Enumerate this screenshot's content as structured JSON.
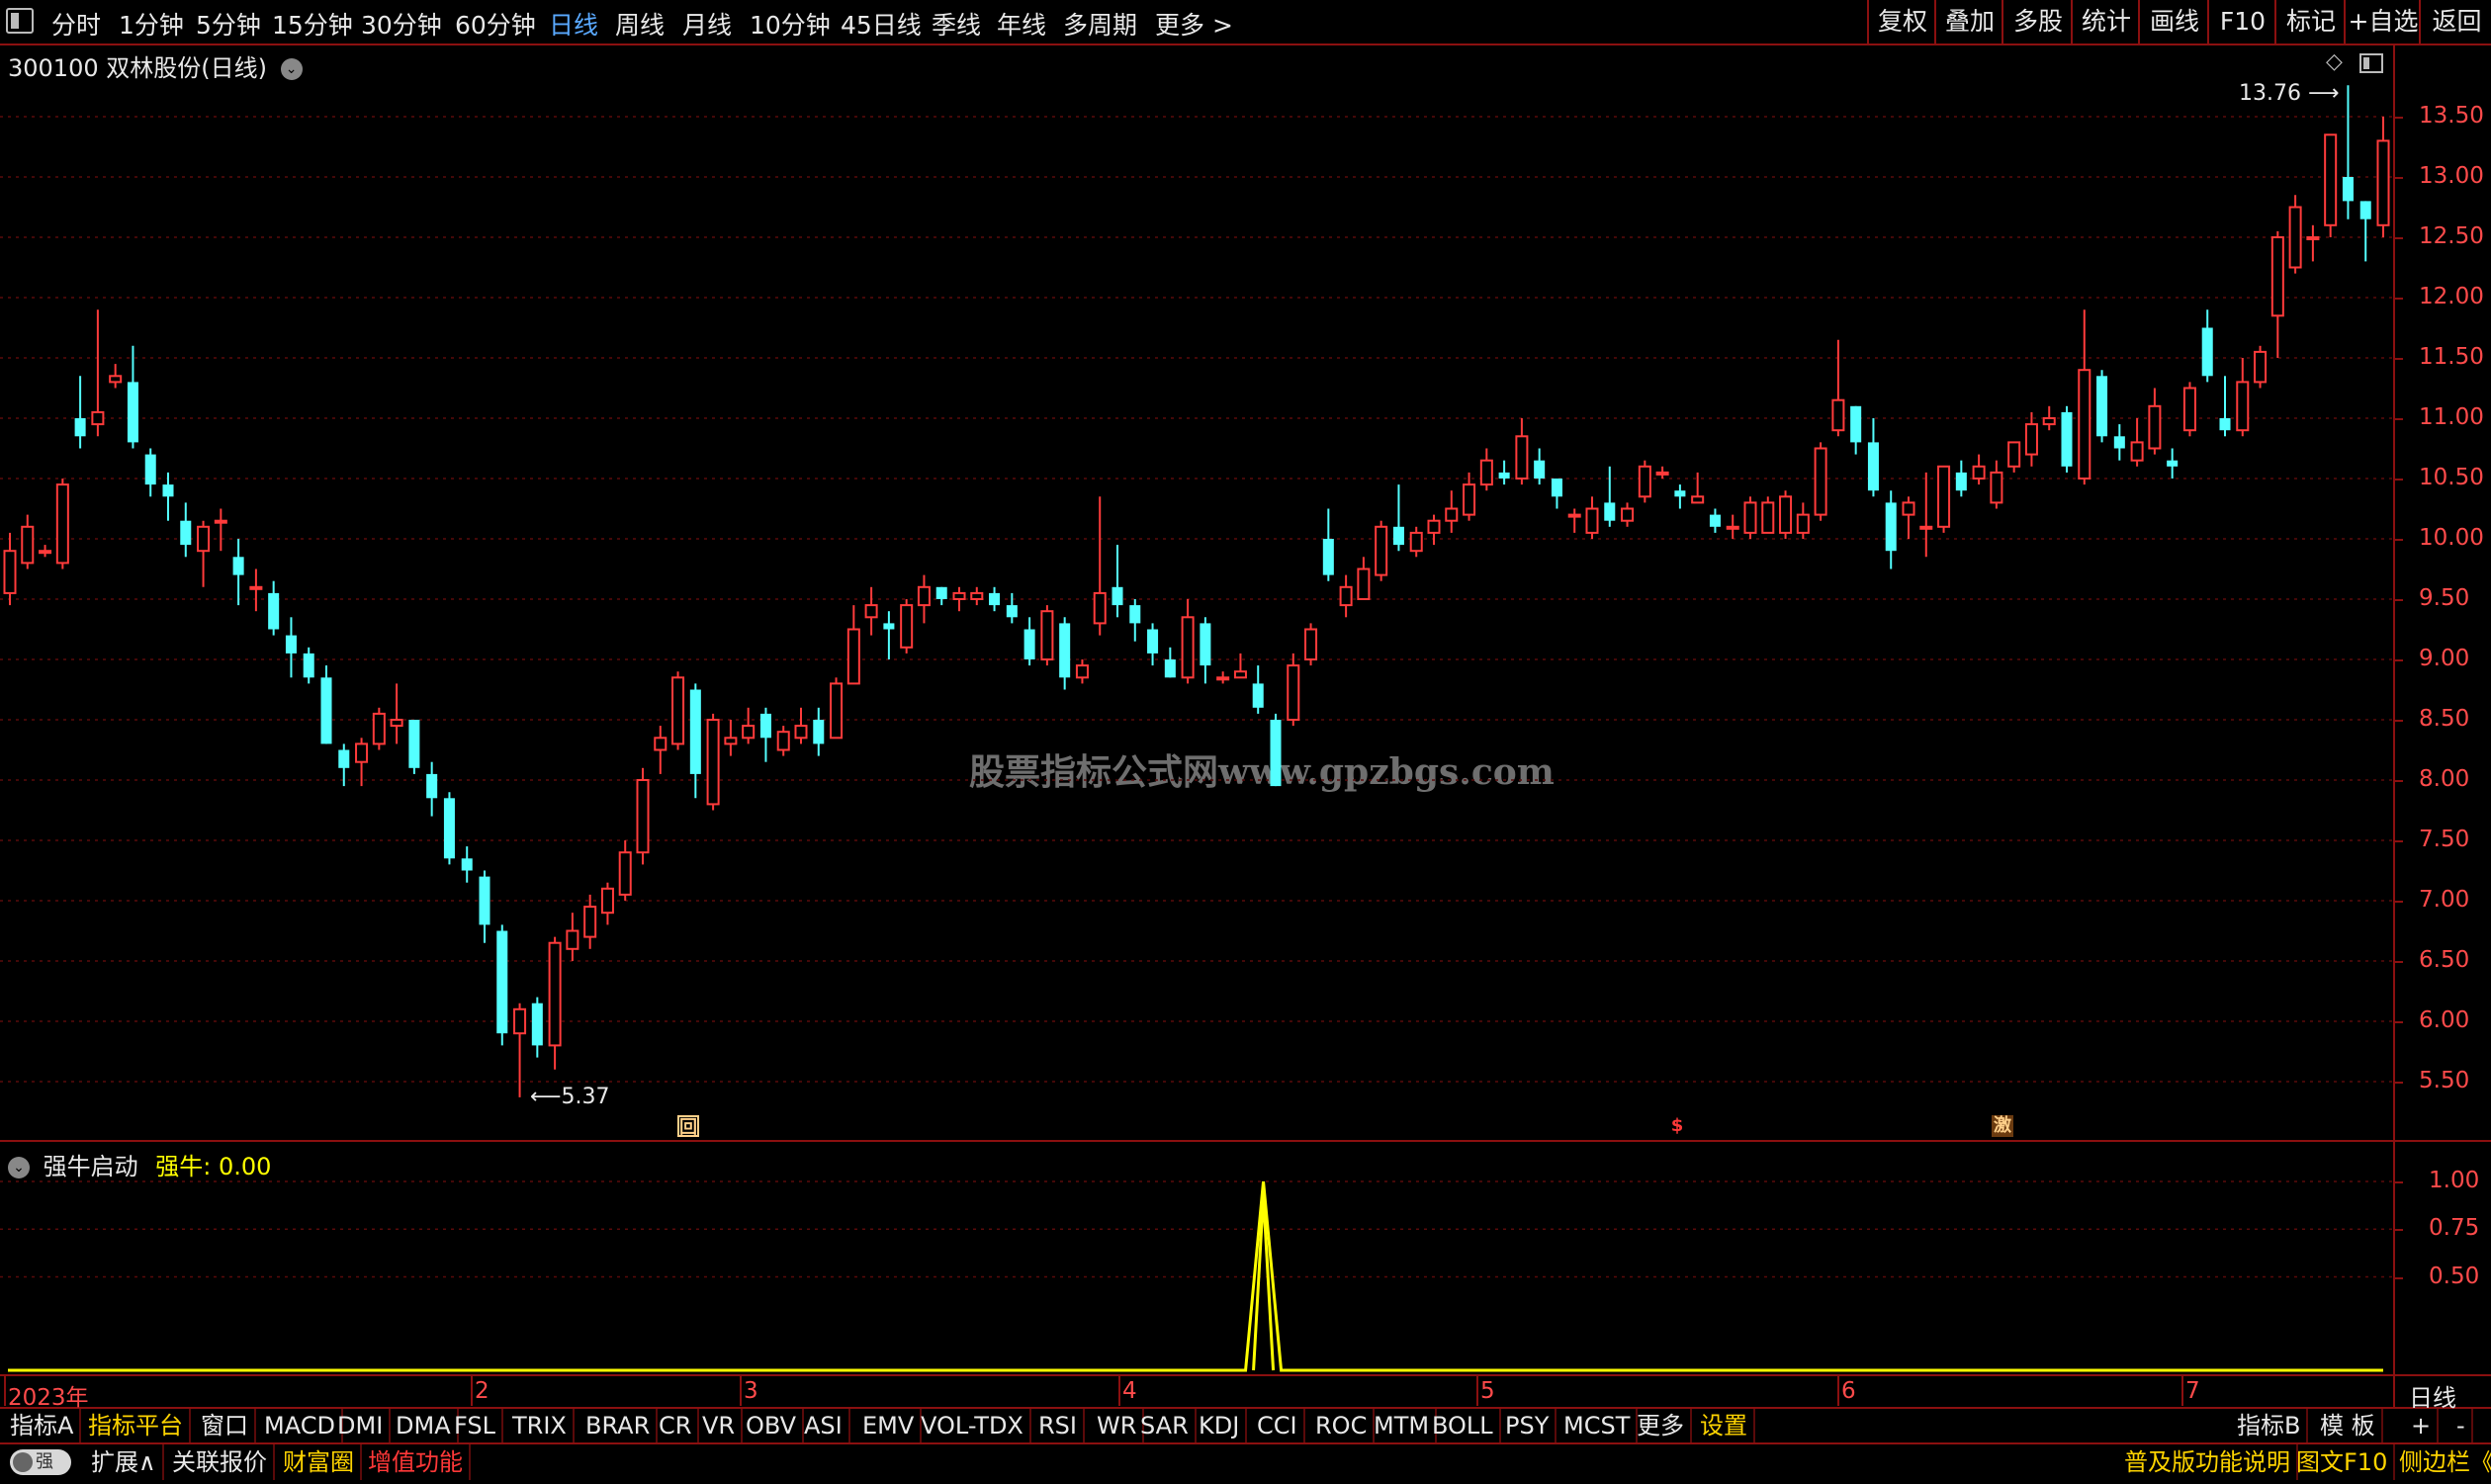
{
  "top_bar": {
    "toggle_icon": "sidebar-toggle-icon",
    "periods": [
      "分时",
      "1分钟",
      "5分钟",
      "15分钟",
      "30分钟",
      "60分钟",
      "日线",
      "周线",
      "月线",
      "10分钟",
      "45日线",
      "季线",
      "年线",
      "多周期",
      "更多 >"
    ],
    "active_period": "日线",
    "right_buttons": [
      "复权",
      "叠加",
      "多股",
      "统计",
      "画线",
      "F10",
      "标记",
      "+自选",
      "返回"
    ]
  },
  "main_chart": {
    "stock_title": "300100 双林股份(日线)",
    "high_label": "13.76",
    "low_label": "5.37",
    "watermark": "股票指标公式网www.gpzbgs.com",
    "markers": [
      {
        "text": "回",
        "color": "#ffd08a"
      },
      {
        "text": "$",
        "color": "#ff3838"
      },
      {
        "text": "激",
        "color": "#ffd08a"
      }
    ],
    "price_axis": [
      "13.50",
      "13.00",
      "12.50",
      "12.00",
      "11.50",
      "11.00",
      "10.50",
      "10.00",
      "9.50",
      "9.00",
      "8.50",
      "8.00",
      "7.50",
      "7.00",
      "6.50",
      "6.00",
      "5.50"
    ],
    "up_color": "#ff3b3b",
    "down_color": "#54ffff"
  },
  "indicator": {
    "name": "强牛启动",
    "value_label": "强牛",
    "value": ": 0.00",
    "axis": [
      "1.00",
      "0.75",
      "0.50"
    ],
    "line_color": "#ffff00"
  },
  "date_axis": [
    "2023年",
    "2",
    "3",
    "4",
    "5",
    "6",
    "7"
  ],
  "period_badge": "日线",
  "bottom_bar": {
    "tabs": [
      "指标A",
      "指标平台",
      "窗口",
      "MACD",
      "DMI",
      "DMA",
      "FSL",
      "TRIX",
      "BRAR",
      "CR",
      "VR",
      "OBV",
      "ASI",
      "EMV",
      "VOL-TDX",
      "RSI",
      "WR",
      "SAR",
      "KDJ",
      "CCI",
      "ROC",
      "MTM",
      "BOLL",
      "PSY",
      "MCST",
      "更多",
      "设置"
    ],
    "right_tabs": [
      "指标B",
      "模 板",
      "+",
      "-"
    ],
    "row2_left": [
      "强",
      "扩展∧",
      "关联报价",
      "财富圈",
      "增值功能"
    ],
    "row2_right": [
      "普及版功能说明",
      "图文F10",
      "侧边栏《"
    ]
  },
  "chart_data": {
    "type": "candlestick",
    "title": "300100 双林股份(日线)",
    "ylim": [
      5.2,
      13.9
    ],
    "x_ticks": [
      "2023年",
      "2",
      "3",
      "4",
      "5",
      "6",
      "7"
    ],
    "candles": [
      [
        9.55,
        9.9,
        9.45,
        10.05
      ],
      [
        9.8,
        10.1,
        9.75,
        10.2
      ],
      [
        9.9,
        9.9,
        9.85,
        9.95
      ],
      [
        9.8,
        10.45,
        9.75,
        10.5
      ],
      [
        11.0,
        10.85,
        10.75,
        11.35
      ],
      [
        10.95,
        11.05,
        10.85,
        11.9
      ],
      [
        11.3,
        11.35,
        11.25,
        11.45
      ],
      [
        11.3,
        10.8,
        10.75,
        11.6
      ],
      [
        10.7,
        10.45,
        10.35,
        10.75
      ],
      [
        10.45,
        10.35,
        10.15,
        10.55
      ],
      [
        10.15,
        9.95,
        9.85,
        10.3
      ],
      [
        9.9,
        10.1,
        9.6,
        10.15
      ],
      [
        10.15,
        10.15,
        9.9,
        10.25
      ],
      [
        9.85,
        9.7,
        9.45,
        10.0
      ],
      [
        9.6,
        9.6,
        9.4,
        9.75
      ],
      [
        9.55,
        9.25,
        9.2,
        9.65
      ],
      [
        9.2,
        9.05,
        8.85,
        9.35
      ],
      [
        9.05,
        8.85,
        8.8,
        9.1
      ],
      [
        8.85,
        8.3,
        8.3,
        8.95
      ],
      [
        8.25,
        8.1,
        7.95,
        8.3
      ],
      [
        8.15,
        8.3,
        7.95,
        8.35
      ],
      [
        8.3,
        8.55,
        8.25,
        8.6
      ],
      [
        8.45,
        8.5,
        8.3,
        8.8
      ],
      [
        8.5,
        8.1,
        8.05,
        8.5
      ],
      [
        8.05,
        7.85,
        7.7,
        8.15
      ],
      [
        7.85,
        7.35,
        7.3,
        7.9
      ],
      [
        7.35,
        7.25,
        7.15,
        7.45
      ],
      [
        7.2,
        6.8,
        6.65,
        7.25
      ],
      [
        6.75,
        5.9,
        5.8,
        6.8
      ],
      [
        5.9,
        6.1,
        5.37,
        6.15
      ],
      [
        6.15,
        5.8,
        5.7,
        6.2
      ],
      [
        5.8,
        6.65,
        5.6,
        6.7
      ],
      [
        6.6,
        6.75,
        6.5,
        6.9
      ],
      [
        6.7,
        6.95,
        6.6,
        7.05
      ],
      [
        6.9,
        7.1,
        6.8,
        7.15
      ],
      [
        7.05,
        7.4,
        7.0,
        7.5
      ],
      [
        7.4,
        8.0,
        7.3,
        8.1
      ],
      [
        8.25,
        8.35,
        8.05,
        8.45
      ],
      [
        8.3,
        8.85,
        8.25,
        8.9
      ],
      [
        8.75,
        8.05,
        7.85,
        8.8
      ],
      [
        7.8,
        8.5,
        7.75,
        8.55
      ],
      [
        8.3,
        8.35,
        8.2,
        8.5
      ],
      [
        8.35,
        8.45,
        8.3,
        8.6
      ],
      [
        8.55,
        8.35,
        8.15,
        8.6
      ],
      [
        8.25,
        8.4,
        8.2,
        8.45
      ],
      [
        8.35,
        8.45,
        8.3,
        8.6
      ],
      [
        8.5,
        8.3,
        8.2,
        8.6
      ],
      [
        8.35,
        8.8,
        8.35,
        8.85
      ],
      [
        8.8,
        9.25,
        8.85,
        9.45
      ],
      [
        9.35,
        9.45,
        9.2,
        9.6
      ],
      [
        9.3,
        9.25,
        9.0,
        9.4
      ],
      [
        9.1,
        9.45,
        9.05,
        9.5
      ],
      [
        9.45,
        9.6,
        9.3,
        9.7
      ],
      [
        9.6,
        9.5,
        9.45,
        9.6
      ],
      [
        9.5,
        9.55,
        9.4,
        9.6
      ],
      [
        9.5,
        9.55,
        9.45,
        9.6
      ],
      [
        9.55,
        9.45,
        9.4,
        9.6
      ],
      [
        9.45,
        9.35,
        9.3,
        9.55
      ],
      [
        9.25,
        9.0,
        8.95,
        9.35
      ],
      [
        9.0,
        9.4,
        8.95,
        9.45
      ],
      [
        9.3,
        8.85,
        8.75,
        9.35
      ],
      [
        8.85,
        8.95,
        8.8,
        9.0
      ],
      [
        9.3,
        9.55,
        9.2,
        10.35
      ],
      [
        9.6,
        9.45,
        9.35,
        9.95
      ],
      [
        9.45,
        9.3,
        9.15,
        9.5
      ],
      [
        9.25,
        9.05,
        8.95,
        9.3
      ],
      [
        9.0,
        8.85,
        8.85,
        9.1
      ],
      [
        8.85,
        9.35,
        8.8,
        9.5
      ],
      [
        9.3,
        8.95,
        8.8,
        9.35
      ],
      [
        8.85,
        8.85,
        8.8,
        8.9
      ],
      [
        8.85,
        8.9,
        8.85,
        9.05
      ],
      [
        8.8,
        8.6,
        8.55,
        8.95
      ],
      [
        8.5,
        7.95,
        7.95,
        8.55
      ],
      [
        8.5,
        8.95,
        8.45,
        9.05
      ],
      [
        9.0,
        9.25,
        8.95,
        9.3
      ],
      [
        10.0,
        9.7,
        9.65,
        10.25
      ],
      [
        9.45,
        9.6,
        9.35,
        9.7
      ],
      [
        9.5,
        9.75,
        9.5,
        9.85
      ],
      [
        9.7,
        10.1,
        9.65,
        10.15
      ],
      [
        10.1,
        9.95,
        9.9,
        10.45
      ],
      [
        9.9,
        10.05,
        9.85,
        10.1
      ],
      [
        10.05,
        10.15,
        9.95,
        10.2
      ],
      [
        10.15,
        10.25,
        10.05,
        10.4
      ],
      [
        10.2,
        10.45,
        10.15,
        10.55
      ],
      [
        10.45,
        10.65,
        10.4,
        10.75
      ],
      [
        10.55,
        10.5,
        10.45,
        10.65
      ],
      [
        10.5,
        10.85,
        10.45,
        11.0
      ],
      [
        10.65,
        10.5,
        10.45,
        10.75
      ],
      [
        10.5,
        10.35,
        10.25,
        10.5
      ],
      [
        10.2,
        10.2,
        10.05,
        10.25
      ],
      [
        10.05,
        10.25,
        10.0,
        10.35
      ],
      [
        10.3,
        10.15,
        10.1,
        10.6
      ],
      [
        10.15,
        10.25,
        10.1,
        10.3
      ],
      [
        10.35,
        10.6,
        10.3,
        10.65
      ],
      [
        10.55,
        10.55,
        10.5,
        10.6
      ],
      [
        10.4,
        10.35,
        10.25,
        10.45
      ],
      [
        10.3,
        10.35,
        10.3,
        10.55
      ],
      [
        10.2,
        10.1,
        10.05,
        10.25
      ],
      [
        10.1,
        10.1,
        10.0,
        10.2
      ],
      [
        10.05,
        10.3,
        10.0,
        10.35
      ],
      [
        10.05,
        10.3,
        10.05,
        10.35
      ],
      [
        10.05,
        10.35,
        10.0,
        10.4
      ],
      [
        10.05,
        10.2,
        10.0,
        10.3
      ],
      [
        10.2,
        10.75,
        10.15,
        10.8
      ],
      [
        10.9,
        11.15,
        10.85,
        11.65
      ],
      [
        11.1,
        10.8,
        10.7,
        11.1
      ],
      [
        10.8,
        10.4,
        10.35,
        11.0
      ],
      [
        10.3,
        9.9,
        9.75,
        10.4
      ],
      [
        10.2,
        10.3,
        10.0,
        10.35
      ],
      [
        10.1,
        10.1,
        9.85,
        10.55
      ],
      [
        10.1,
        10.6,
        10.05,
        10.6
      ],
      [
        10.55,
        10.4,
        10.35,
        10.65
      ],
      [
        10.5,
        10.6,
        10.45,
        10.7
      ],
      [
        10.3,
        10.55,
        10.25,
        10.65
      ],
      [
        10.6,
        10.8,
        10.55,
        10.8
      ],
      [
        10.7,
        10.95,
        10.6,
        11.05
      ],
      [
        10.95,
        11.0,
        10.9,
        11.1
      ],
      [
        11.05,
        10.6,
        10.55,
        11.1
      ],
      [
        10.5,
        11.4,
        10.45,
        11.9
      ],
      [
        11.35,
        10.85,
        10.8,
        11.4
      ],
      [
        10.85,
        10.75,
        10.65,
        10.95
      ],
      [
        10.65,
        10.8,
        10.6,
        11.0
      ],
      [
        10.75,
        11.1,
        10.7,
        11.25
      ],
      [
        10.65,
        10.6,
        10.5,
        10.75
      ],
      [
        10.9,
        11.25,
        10.85,
        11.3
      ],
      [
        11.75,
        11.35,
        11.3,
        11.9
      ],
      [
        11.0,
        10.9,
        10.85,
        11.35
      ],
      [
        10.9,
        11.3,
        10.85,
        11.5
      ],
      [
        11.3,
        11.55,
        11.25,
        11.6
      ],
      [
        11.85,
        12.5,
        11.5,
        12.55
      ],
      [
        12.25,
        12.75,
        12.2,
        12.85
      ],
      [
        12.5,
        12.5,
        12.3,
        12.6
      ],
      [
        12.6,
        13.35,
        12.5,
        13.35
      ],
      [
        13.0,
        12.8,
        12.65,
        13.76
      ],
      [
        12.8,
        12.65,
        12.3,
        12.8
      ],
      [
        12.6,
        13.3,
        12.5,
        13.5
      ]
    ],
    "indicator_values": "0 everywhere, 1.00 on one day between months 4 and 5"
  }
}
